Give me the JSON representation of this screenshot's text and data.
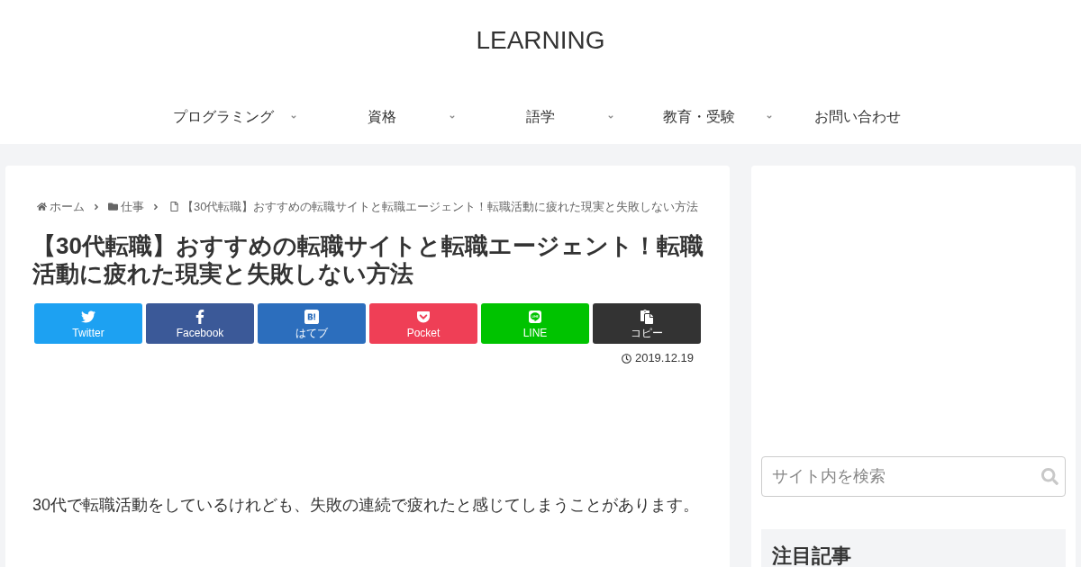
{
  "site_title": "LEARNING",
  "nav": [
    {
      "label": "プログラミング",
      "has_submenu": true
    },
    {
      "label": "資格",
      "has_submenu": true
    },
    {
      "label": "語学",
      "has_submenu": true
    },
    {
      "label": "教育・受験",
      "has_submenu": true
    },
    {
      "label": "お問い合わせ",
      "has_submenu": false
    }
  ],
  "breadcrumb": [
    {
      "kind": "home",
      "label": "ホーム"
    },
    {
      "kind": "category",
      "label": "仕事"
    },
    {
      "kind": "page",
      "label": "【30代転職】おすすめの転職サイトと転職エージェント！転職活動に疲れた現実と失敗しない方法"
    }
  ],
  "article": {
    "title": "【30代転職】おすすめの転職サイトと転職エージェント！転職活動に疲れた現実と失敗しない方法",
    "share_buttons": [
      {
        "kind": "twitter",
        "label": "Twitter",
        "color": "#1da1f2"
      },
      {
        "kind": "facebook",
        "label": "Facebook",
        "color": "#3b5998"
      },
      {
        "kind": "hatena",
        "label": "はてブ",
        "color": "#2c6ebd"
      },
      {
        "kind": "pocket",
        "label": "Pocket",
        "color": "#ef3f56"
      },
      {
        "kind": "line",
        "label": "LINE",
        "color": "#00c300"
      },
      {
        "kind": "copy",
        "label": "コピー",
        "color": "#333333"
      }
    ],
    "date": "2019.12.19",
    "paragraph": "30代で転職活動をしているけれども、失敗の連続で疲れたと感じてしまうことがあります。"
  },
  "sidebar": {
    "search": {
      "placeholder": "サイト内を検索"
    },
    "widget_title": "注目記事"
  }
}
